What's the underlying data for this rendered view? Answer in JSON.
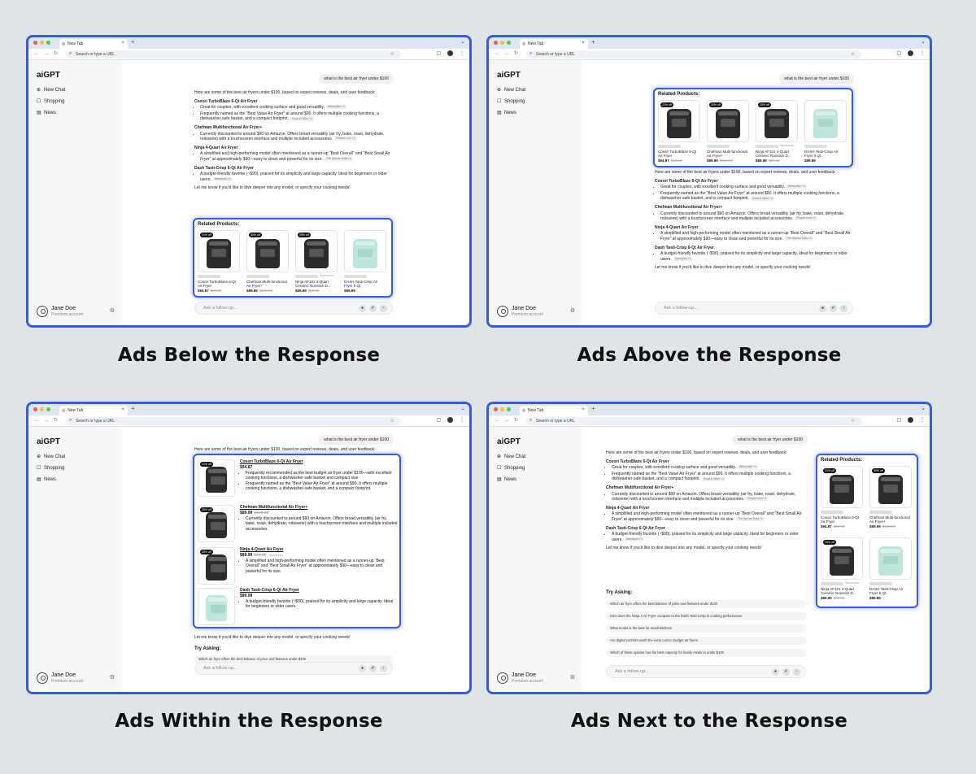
{
  "browser": {
    "tab_title": "New Tab",
    "url_placeholder": "Search or type a URL"
  },
  "app": {
    "brand": "aiGPT",
    "nav": [
      "New Chat",
      "Shopping",
      "News"
    ],
    "user_name": "Jane Doe",
    "user_plan": "Premium account",
    "follow_placeholder": "Ask a follow-up..."
  },
  "query": "what is the best air fryer under $100",
  "intro": "Here are some of the best air fryers under $100, based on expert reviews, deals, and user feedback:",
  "sections": [
    {
      "title": "Cosori TurboBlaze 6-Qt Air Fryer",
      "bullets": [
        "Great for couples, with excellent cooking surface and good versatility.",
        "Frequently named as the “Best Value Air Fryer” at around $90. It offers multiple cooking functions, a dishwasher-safe basket, and a compact footprint."
      ],
      "cites": [
        "Wirecutter +1",
        "Food & Wine +1"
      ]
    },
    {
      "title": "Chefman Multifunctional Air Fryer+",
      "bullets": [
        "Currently discounted to around $90 on Amazon. Offers broad versatility (air fry, bake, roast, dehydrate, rotisserie) with a touchscreen interface and multiple included accessories."
      ],
      "cites": [
        "People.com +1"
      ]
    },
    {
      "title": "Ninja 4-Quart Air Fryer",
      "bullets": [
        "A simplified and high-performing model often mentioned as a runner-up “Best Overall” and “Best Small Air Fryer” at approximately $90—easy to clean and powerful for its size."
      ],
      "cites": [
        "The Spruce Eats +1"
      ]
    },
    {
      "title": "Dash Tasti-Crisp 6-Qt Air Fryer",
      "bullets": [
        "A budget-friendly favorite (~$90), praised for its simplicity and large capacity. Ideal for beginners or older users."
      ],
      "cites": [
        "Allrecipes +1"
      ]
    }
  ],
  "closing": "Let me know if you'd like to dive deeper into any model, or specify your cooking needs!",
  "related_title": "Related Products:",
  "products": [
    {
      "badge": "21% off",
      "name": "Cosori TurboBlaze 6-Qt Air Fryer",
      "price": "$94.87",
      "old": "$99.99",
      "color": "dark",
      "sponsored": ""
    },
    {
      "badge": "30% off",
      "name": "Chefman Multi-functional Air Fryer+",
      "price": "$89.99",
      "old": "$129.99",
      "color": "dark",
      "sponsored": ""
    },
    {
      "badge": "25% off",
      "name": "Ninja AF101 4-Quart Ceramic Nonstick D...",
      "price": "$89.99",
      "old": "$99.99",
      "color": "dark",
      "sponsored": "Sponsored"
    },
    {
      "badge": "",
      "name": "DASH Tasti-Crisp Air Fryer 6 Qt.",
      "price": "$89.99",
      "old": "",
      "color": "mint",
      "sponsored": ""
    }
  ],
  "inline_items": [
    {
      "badge": "21% off",
      "title": "Cosori TurboBlaze 6-Qt Air Fryer",
      "price": "$94.87",
      "old": "",
      "sponsored": "",
      "bullets": [
        "Frequently recommended as the best budget air fryer under $100—with excellent cooking functions, a dishwasher-safe basket and compact size.",
        "Frequently named as the “Best Value Air Fryer” at around $90. It offers multiple cooking functions, a dishwasher-safe basket, and a compact footprint."
      ],
      "color": "dark"
    },
    {
      "badge": "30% off",
      "title": "Chefman Multifunctional Air Fryer+",
      "price": "$89.99",
      "old": "$129.99",
      "sponsored": "",
      "bullets": [
        "Currently discounted to around $90 on Amazon. Offers broad versatility (air fry, bake, roast, dehydrate, rotisserie) with a touchscreen interface and multiple included accessories."
      ],
      "color": "dark"
    },
    {
      "badge": "25% off",
      "title": "Ninja 4-Quart Air Fryer",
      "price": "$89.99",
      "old": "$99.99",
      "sponsored": "Sponsored",
      "bullets": [
        "A simplified and high-performing model often mentioned as a runner-up “Best Overall” and “Best Small Air Fryer” at approximately $90—easy to clean and powerful for its size."
      ],
      "color": "dark"
    },
    {
      "badge": "",
      "title": "Dash Tasti-Crisp 6-Qt Air Fryer",
      "price": "$89.99",
      "old": "",
      "sponsored": "",
      "bullets": [
        "A budget-friendly favorite (~$90), praised for its simplicity and large capacity. Ideal for beginners or older users."
      ],
      "color": "mint"
    }
  ],
  "try_asking": {
    "title": "Try Asking:",
    "items": [
      "Which air fryer offers the best balance of price and features under $100",
      "How does the Ninja 4 Air Fryer compare to the Dash Tasti-Crisp in cooking performance",
      "What model is the best for small kitchens",
      "Are digital controls worth the extra cost in budget air fryers",
      "Which of these options has the best capacity for family meals in under $100"
    ]
  },
  "captions": [
    "Ads Below the Response",
    "Ads Above the Response",
    "Ads Within the Response",
    "Ads Next to the Response"
  ],
  "colors": {
    "accent": "#3b5bd0",
    "background": "#dfe4e7"
  }
}
